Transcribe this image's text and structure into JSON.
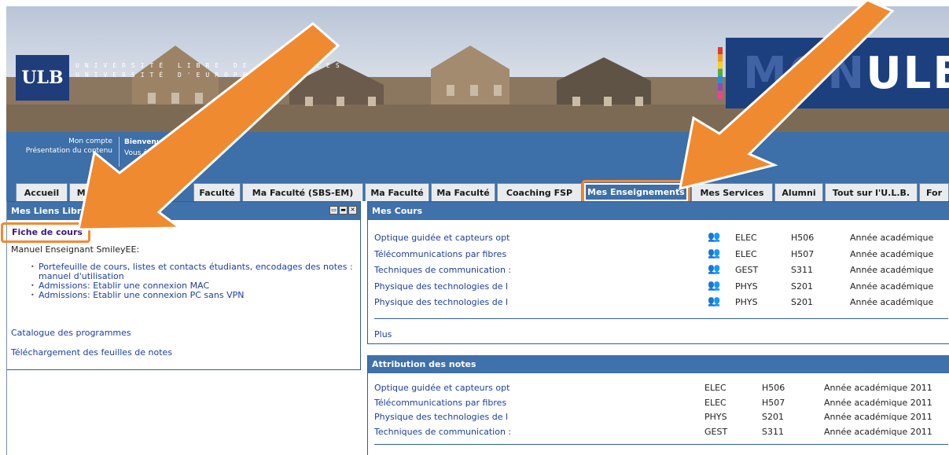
{
  "banner": {
    "logo_text": "ULB",
    "university_line1": "UNIVERSITÉ LIBRE DE BRUXELLES",
    "university_line2": "UNIVERSITÉ D'EUROPE",
    "monulb_prefix": "MON",
    "monulb_suffix": "ULB"
  },
  "welcome": {
    "mon_compte": "Mon compte",
    "presentation": "Présentation du contenu",
    "greeting": "Bienvenue Phi",
    "status": "Vous êtes co"
  },
  "tabs": [
    {
      "label": "Accueil"
    },
    {
      "label": "Mon Bureau Vi"
    },
    {
      "label": "Faculté"
    },
    {
      "label": "Ma Faculté (SBS-EM)"
    },
    {
      "label": "Ma Faculté"
    },
    {
      "label": "Ma Faculté"
    },
    {
      "label": "Coaching FSP"
    },
    {
      "label": "Mes Enseignements"
    },
    {
      "label": "Mes Services"
    },
    {
      "label": "Alumni"
    },
    {
      "label": "Tout sur l'U.L.B."
    },
    {
      "label": "For"
    }
  ],
  "left_panel": {
    "title": "Mes Liens Libre Service",
    "fiche": "Fiche de cours",
    "manuel": "Manuel Enseignant SmileyEE:",
    "bullets": [
      "Portefeuille de cours, listes et contacts étudiants, encodages des notes : manuel d'utilisation",
      "Admissions: Etablir une connexion MAC",
      "Admissions: Etablir une connexion PC sans VPN"
    ],
    "catalogue": "Catalogue des programmes",
    "telechargement": "Téléchargement des feuilles de notes"
  },
  "mes_cours": {
    "title": "Mes Cours",
    "rows": [
      {
        "name": "Optique guidée et capteurs opt",
        "dept": "ELEC",
        "code": "H506",
        "year": "Année académique"
      },
      {
        "name": "Télécommunications par fibres",
        "dept": "ELEC",
        "code": "H507",
        "year": "Année académique"
      },
      {
        "name": "Techniques de communication :",
        "dept": "GEST",
        "code": "S311",
        "year": "Année académique"
      },
      {
        "name": "Physique des technologies de l",
        "dept": "PHYS",
        "code": "S201",
        "year": "Année académique"
      },
      {
        "name": "Physique des technologies de l",
        "dept": "PHYS",
        "code": "S201",
        "year": "Année académique"
      }
    ],
    "plus": "Plus"
  },
  "attribution": {
    "title": "Attribution des notes",
    "rows": [
      {
        "name": "Optique guidée et capteurs opt",
        "dept": "ELEC",
        "code": "H506",
        "year": "Année académique 2011"
      },
      {
        "name": "Télécommunications par fibres",
        "dept": "ELEC",
        "code": "H507",
        "year": "Année académique 2011"
      },
      {
        "name": "Physique des technologies de l",
        "dept": "PHYS",
        "code": "S201",
        "year": "Année académique 2011"
      },
      {
        "name": "Techniques de communication :",
        "dept": "GEST",
        "code": "S311",
        "year": "Année académique 2011"
      }
    ]
  },
  "icons": {
    "people": "people-icon",
    "window_controls": [
      "restore-icon",
      "minimize-icon",
      "close-icon"
    ]
  },
  "colors": {
    "header_blue": "#3f71ab",
    "accent_orange": "#f08a30",
    "link": "#1d3f9a"
  }
}
